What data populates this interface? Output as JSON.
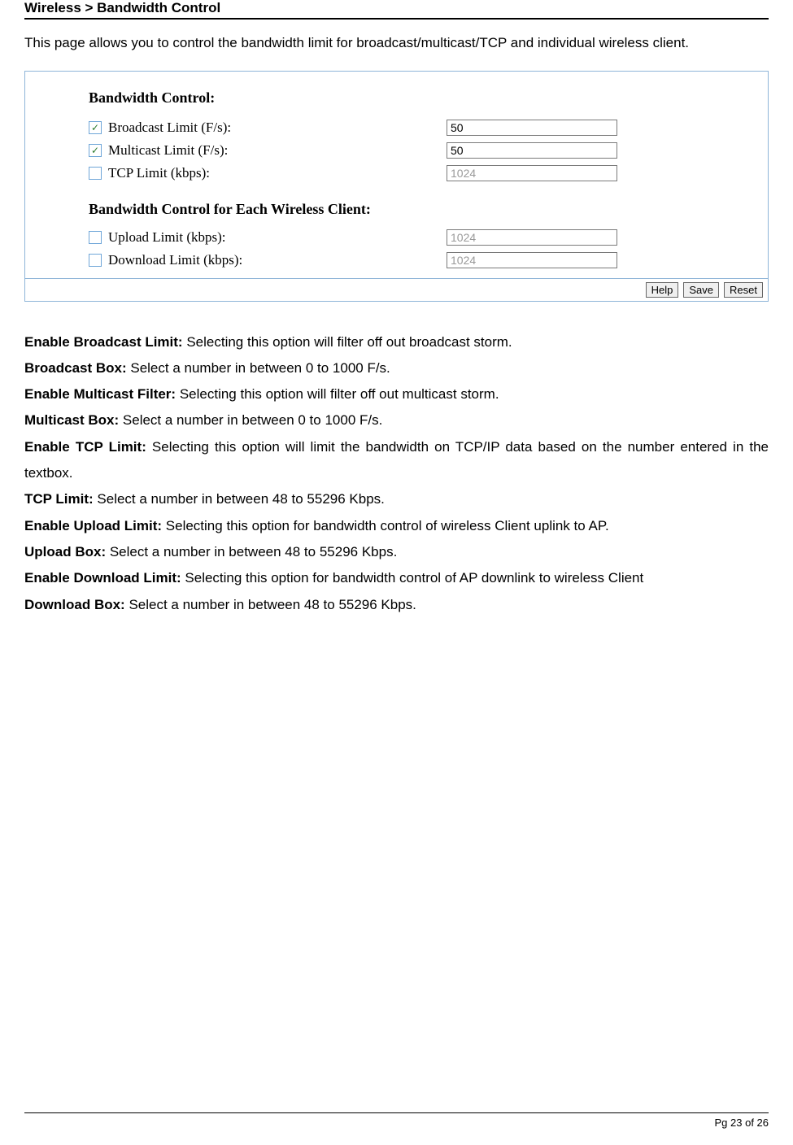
{
  "heading": "Wireless > Bandwidth Control",
  "intro": "This page allows you to control the bandwidth limit for broadcast/multicast/TCP and individual wireless client.",
  "panel": {
    "title1": "Bandwidth Control:",
    "rows1": [
      {
        "checked": true,
        "label": "Broadcast Limit (F/s):",
        "value": "50",
        "disabled": false
      },
      {
        "checked": true,
        "label": "Multicast Limit (F/s):",
        "value": "50",
        "disabled": false
      },
      {
        "checked": false,
        "label": "TCP Limit (kbps):",
        "value": "1024",
        "disabled": true
      }
    ],
    "title2": "Bandwidth Control for Each Wireless Client:",
    "rows2": [
      {
        "checked": false,
        "label": "Upload Limit (kbps):",
        "value": "1024",
        "disabled": true
      },
      {
        "checked": false,
        "label": "Download Limit (kbps):",
        "value": "1024",
        "disabled": true
      }
    ],
    "buttons": {
      "help": "Help",
      "save": "Save",
      "reset": "Reset"
    }
  },
  "defs": [
    {
      "k": "Enable Broadcast Limit:",
      "t": " Selecting this option will filter off out broadcast storm."
    },
    {
      "k": "Broadcast Box:",
      "t": " Select a number in between 0 to 1000 F/s."
    },
    {
      "k": "Enable Multicast Filter:",
      "t": " Selecting this option will filter off out multicast storm."
    },
    {
      "k": "Multicast Box:",
      "t": " Select a number in between 0 to 1000 F/s."
    },
    {
      "k": "Enable TCP Limit:",
      "t": " Selecting this option will limit the bandwidth on TCP/IP data based on the number entered in the textbox."
    },
    {
      "k": "TCP Limit:",
      "t": " Select a number in between 48 to 55296 Kbps."
    },
    {
      "k": "Enable Upload Limit:",
      "t": " Selecting this option for bandwidth control of wireless Client uplink to AP."
    },
    {
      "k": "Upload Box:",
      "t": " Select a number in between 48 to 55296 Kbps."
    },
    {
      "k": "Enable Download Limit:",
      "t": " Selecting this option for bandwidth control of AP downlink to wireless Client"
    },
    {
      "k": "Download Box:",
      "t": " Select a number in between 48 to 55296 Kbps."
    }
  ],
  "footer": "Pg 23 of 26"
}
